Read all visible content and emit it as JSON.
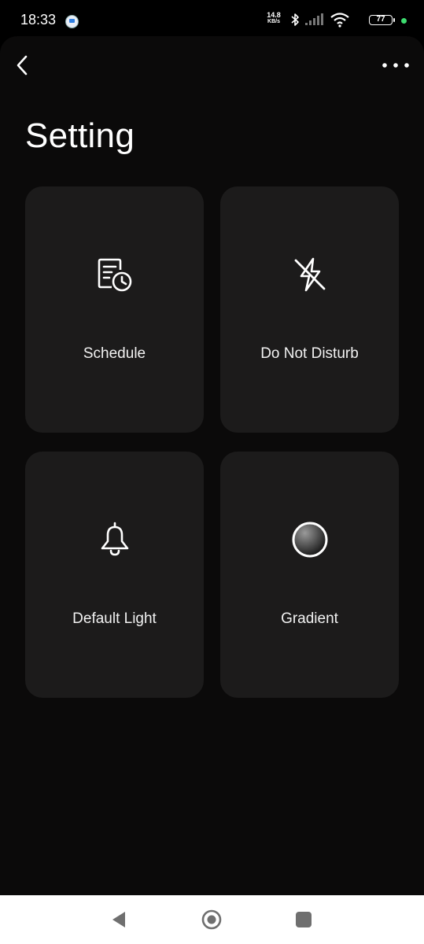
{
  "status_bar": {
    "time": "18:33",
    "net_speed_value": "14.8",
    "net_speed_unit": "KB/s",
    "battery": "77"
  },
  "header": {
    "title": "Setting"
  },
  "tiles": [
    {
      "label": "Schedule",
      "icon": "schedule-icon"
    },
    {
      "label": "Do Not Disturb",
      "icon": "no-flash-icon"
    },
    {
      "label": "Default Light",
      "icon": "bell-icon"
    },
    {
      "label": "Gradient",
      "icon": "gradient-circle-icon"
    }
  ],
  "colors": {
    "background": "#0b0a0a",
    "tile": "#1c1b1b",
    "text": "#ffffff",
    "nav_bar": "#ffffff",
    "privacy_dot": "#3ddc6f"
  },
  "navigation": {
    "back_icon": "triangle-back-icon",
    "home_icon": "circle-home-icon",
    "recents_icon": "square-recents-icon"
  }
}
